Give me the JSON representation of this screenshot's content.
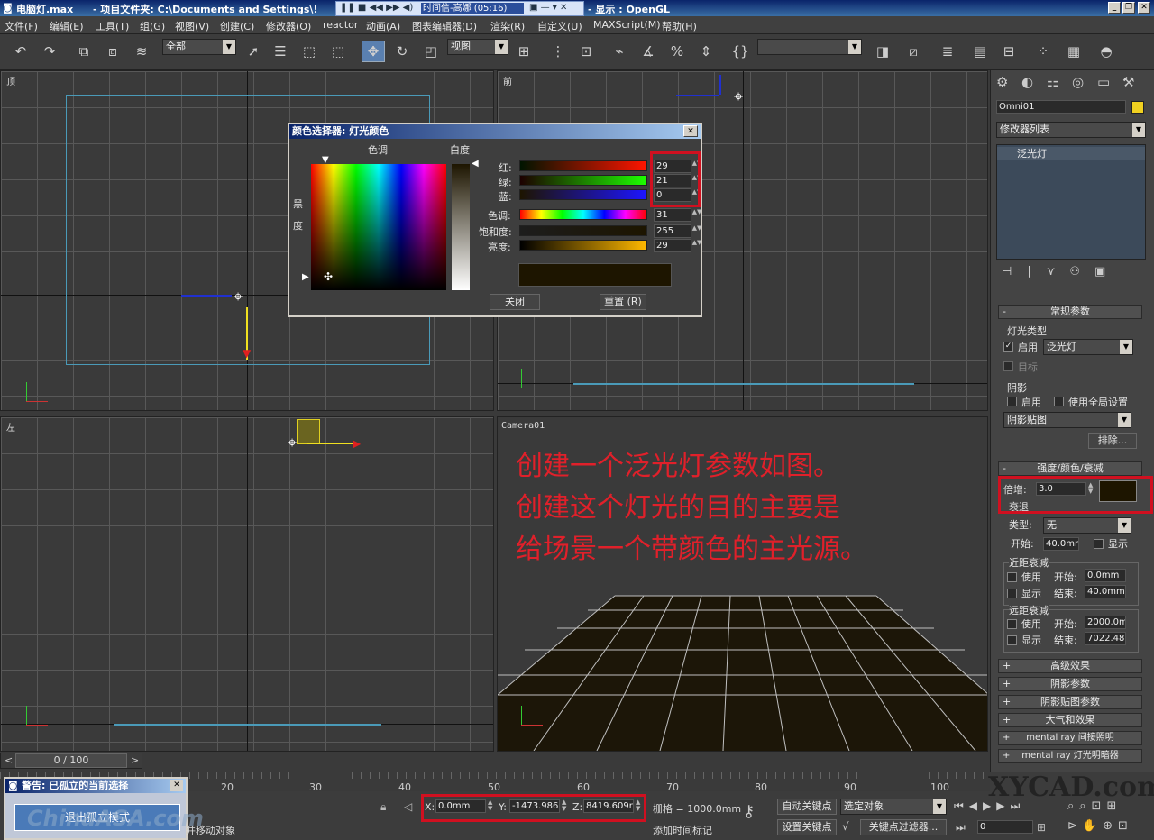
{
  "window": {
    "title": "电脑灯.max",
    "project": "- 项目文件夹: C:\\Documents and Settings\\!",
    "display": "- 显示 : OpenGL"
  },
  "media": {
    "track": "时间信-高娜 (05:16)"
  },
  "menu": [
    "文件(F)",
    "编辑(E)",
    "工具(T)",
    "组(G)",
    "视图(V)",
    "创建(C)",
    "修改器(O)",
    "reactor",
    "动画(A)",
    "图表编辑器(D)",
    "渲染(R)",
    "自定义(U)",
    "MAXScript(M)",
    "帮助(H)"
  ],
  "toolbar": {
    "selection_filter": "全部",
    "ref_coord": "视图",
    "named_sel": ""
  },
  "viewports": {
    "top": "顶",
    "front": "前",
    "left": "左",
    "camera": "Camera01"
  },
  "color_dialog": {
    "title": "颜色选择器: 灯光颜色",
    "hue_label": "色调",
    "white_label": "白度",
    "black_label_1": "黑",
    "black_label_2": "度",
    "red": {
      "label": "红:",
      "value": "29"
    },
    "green": {
      "label": "绿:",
      "value": "21"
    },
    "blue": {
      "label": "蓝:",
      "value": "0"
    },
    "hue": {
      "label": "色调:",
      "value": "31"
    },
    "sat": {
      "label": "饱和度:",
      "value": "255"
    },
    "val": {
      "label": "亮度:",
      "value": "29"
    },
    "swatch": "#1d1500",
    "close": "关闭",
    "reset": "重置 (R)"
  },
  "annotation": [
    "创建一个泛光灯参数如图。",
    "创建这个灯光的目的主要是",
    "给场景一个带颜色的主光源。"
  ],
  "cmd": {
    "object_name": "Omni01",
    "object_color": "#f0d020",
    "modifier_list": "修改器列表",
    "stack_item": "泛光灯",
    "general": "常规参数",
    "light_type": "灯光类型",
    "on": "启用",
    "type_value": "泛光灯",
    "target": "目标",
    "shadows": "阴影",
    "shadow_on": "启用",
    "use_global": "使用全局设置",
    "shadow_type": "阴影贴图",
    "exclude": "排除...",
    "intensity": "强度/颜色/衰减",
    "multiplier_label": "倍增:",
    "multiplier": "3.0",
    "decay": "衰退",
    "decay_type_label": "类型:",
    "decay_type": "无",
    "start_label": "开始:",
    "start_value": "40.0mm",
    "show": "显示",
    "near_atten": "近距衰减",
    "use": "使用",
    "near_start_label": "开始:",
    "near_start": "0.0mm",
    "near_end_label": "结束:",
    "near_end": "40.0mm",
    "far_atten": "远距衰减",
    "far_start": "2000.0m",
    "far_end": "7022.48",
    "rollouts": [
      "高级效果",
      "阴影参数",
      "阴影贴图参数",
      "大气和效果",
      "mental ray 间接照明",
      "mental ray 灯光明暗器"
    ]
  },
  "timeline": {
    "frame": "0 / 100",
    "ticks": [
      "20",
      "30",
      "40",
      "50",
      "60",
      "70",
      "80",
      "90",
      "100"
    ]
  },
  "status": {
    "warning_title": "警告: 已孤立的当前选择",
    "exit_isolation": "退出孤立模式",
    "hint": "并移动对象",
    "x_label": "X:",
    "x": "0.0mm",
    "y_label": "Y:",
    "y": "-1473.986",
    "z_label": "Z:",
    "z": "8419.609r",
    "grid": "栅格 = 1000.0mm",
    "add_time_tag": "添加时间标记",
    "auto_key": "自动关键点",
    "set_key": "设置关键点",
    "selected": "选定对象",
    "key_filters": "关键点过滤器...",
    "frame": "0"
  },
  "watermark": {
    "left": "ChinaASA.com",
    "right": "XYCAD.com"
  }
}
